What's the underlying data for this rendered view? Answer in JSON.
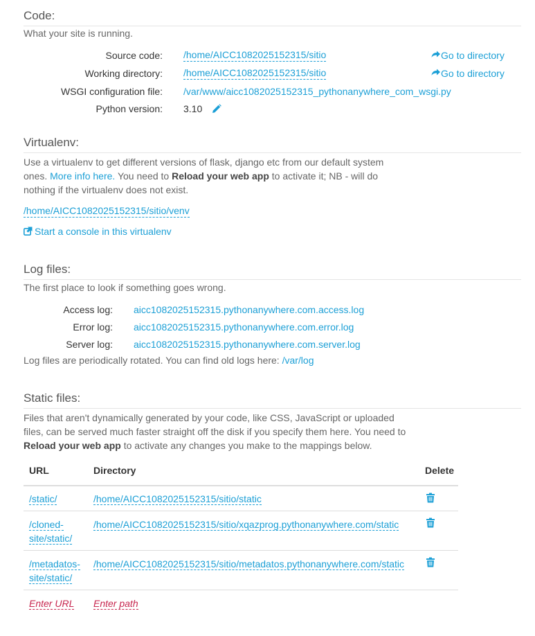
{
  "code": {
    "title": "Code:",
    "description": "What your site is running.",
    "source_label": "Source code:",
    "source_value": "/home/AICC1082025152315/sitio",
    "source_goto": "Go to directory",
    "working_label": "Working directory:",
    "working_value": "/home/AICC1082025152315/sitio",
    "working_goto": "Go to directory",
    "wsgi_label": "WSGI configuration file:",
    "wsgi_value": "/var/www/aicc1082025152315_pythonanywhere_com_wsgi.py",
    "python_label": "Python version:",
    "python_value": "3.10"
  },
  "virtualenv": {
    "title": "Virtualenv:",
    "desc_part1": "Use a virtualenv to get different versions of flask, django etc from our default system ones. ",
    "desc_link": "More info here.",
    "desc_part2": " You need to ",
    "desc_bold": "Reload your web app",
    "desc_part3": " to activate it; NB - will do nothing if the virtualenv does not exist.",
    "path": "/home/AICC1082025152315/sitio/venv",
    "console_link": "Start a console in this virtualenv"
  },
  "logs": {
    "title": "Log files:",
    "description": "The first place to look if something goes wrong.",
    "access_label": "Access log:",
    "access_value": "aicc1082025152315.pythonanywhere.com.access.log",
    "error_label": "Error log:",
    "error_value": "aicc1082025152315.pythonanywhere.com.error.log",
    "server_label": "Server log:",
    "server_value": "aicc1082025152315.pythonanywhere.com.server.log",
    "rotation_text": "Log files are periodically rotated. You can find old logs here: ",
    "rotation_link": "/var/log"
  },
  "static": {
    "title": "Static files:",
    "desc_part1": "Files that aren't dynamically generated by your code, like CSS, JavaScript or uploaded files, can be served much faster straight off the disk if you specify them here. You need to ",
    "desc_bold": "Reload your web app",
    "desc_part2": " to activate any changes you make to the mappings below.",
    "col_url": "URL",
    "col_directory": "Directory",
    "col_delete": "Delete",
    "rows": [
      {
        "url_line1": "/static/",
        "url_line2": "",
        "directory": "/home/AICC1082025152315/sitio/static"
      },
      {
        "url_line1": "/cloned-",
        "url_line2": "site/static/",
        "directory": "/home/AICC1082025152315/sitio/xqazprog.pythonanywhere.com/static"
      },
      {
        "url_line1": "/metadatos-",
        "url_line2": "site/static/",
        "directory": "/home/AICC1082025152315/sitio/metadatos.pythonanywhere.com/static"
      }
    ],
    "enter_url": "Enter URL",
    "enter_path": "Enter path"
  },
  "icons": {
    "goto": "share-arrow-icon",
    "edit": "pencil-icon",
    "console": "external-link-icon",
    "delete": "trash-icon"
  }
}
